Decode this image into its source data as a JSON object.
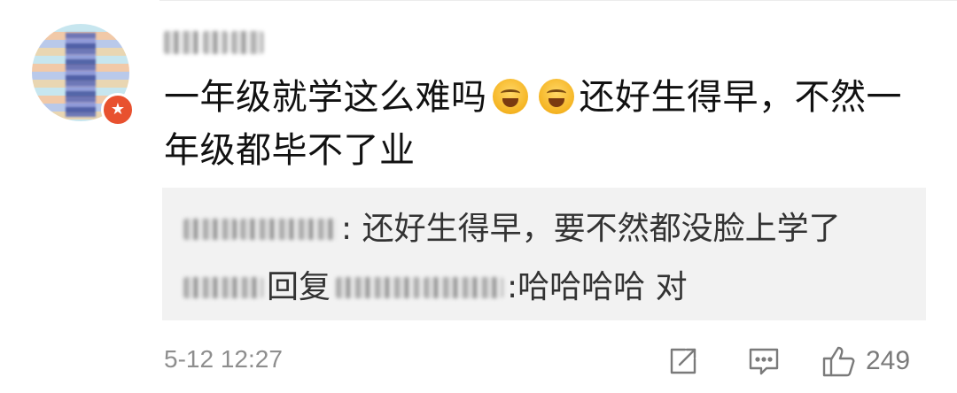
{
  "comment": {
    "text_part1": "一年级就学这么难吗",
    "emoji_name": "laughing-tears-emoji",
    "text_part2": "还好生得早，不然一年级都毕不了业"
  },
  "replies": [
    {
      "text": ": 还好生得早，要不然都没脸上学了"
    },
    {
      "reply_word": "回复",
      "text": ":哈哈哈哈 对"
    }
  ],
  "footer": {
    "timestamp": "5-12 12:27",
    "share_icon": "share-icon",
    "comment_icon": "comment-icon",
    "like_icon": "thumbs-up-icon",
    "like_count": "249"
  },
  "colors": {
    "reply_bg": "#f2f2f2",
    "meta_gray": "#8e8e8e",
    "badge_red": "#e8512f"
  }
}
